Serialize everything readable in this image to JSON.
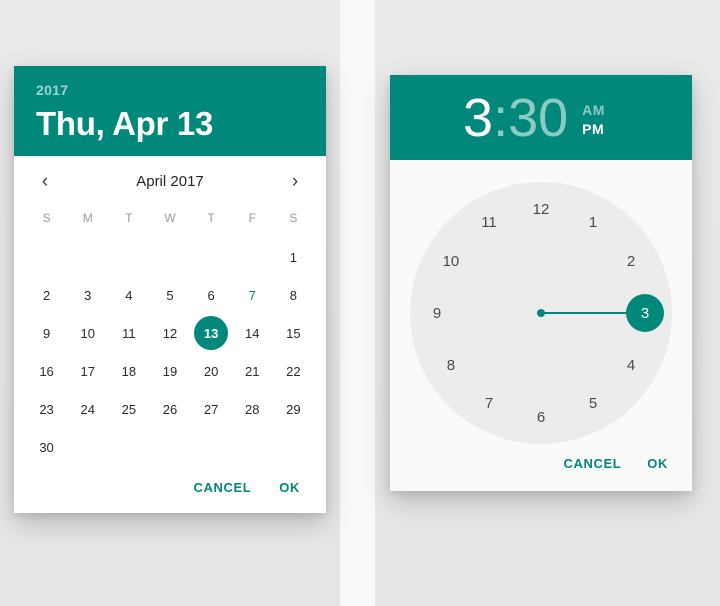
{
  "theme": {
    "accent": "#00897b",
    "panel_bg": "#e8e8e8",
    "gap_bg": "#f9f9f9",
    "card_bg": "#ffffff",
    "clock_face_bg": "#ececec",
    "time_surface_bg": "#fafafa"
  },
  "date_picker": {
    "header": {
      "year": "2017",
      "date_full": "Thu, Apr 13"
    },
    "nav": {
      "prev_icon": "chevron-left-icon",
      "next_icon": "chevron-right-icon",
      "prev_label": "‹",
      "next_label": "›",
      "month_label": "April 2017"
    },
    "weekdays": [
      "S",
      "M",
      "T",
      "W",
      "T",
      "F",
      "S"
    ],
    "leading_blanks": 6,
    "days": [
      1,
      2,
      3,
      4,
      5,
      6,
      7,
      8,
      9,
      10,
      11,
      12,
      13,
      14,
      15,
      16,
      17,
      18,
      19,
      20,
      21,
      22,
      23,
      24,
      25,
      26,
      27,
      28,
      29,
      30
    ],
    "selected_day": 13,
    "today_day": 7,
    "actions": {
      "cancel": "CANCEL",
      "ok": "OK"
    }
  },
  "time_picker": {
    "header": {
      "hour": "3",
      "colon": ":",
      "minute": "30",
      "am": "AM",
      "pm": "PM",
      "active_field": "hour",
      "active_meridiem": "PM"
    },
    "clock": {
      "hours": [
        12,
        1,
        2,
        3,
        4,
        5,
        6,
        7,
        8,
        9,
        10,
        11
      ],
      "selected_hour": 3,
      "hand_angle_deg": 0
    },
    "actions": {
      "cancel": "CANCEL",
      "ok": "OK"
    }
  }
}
